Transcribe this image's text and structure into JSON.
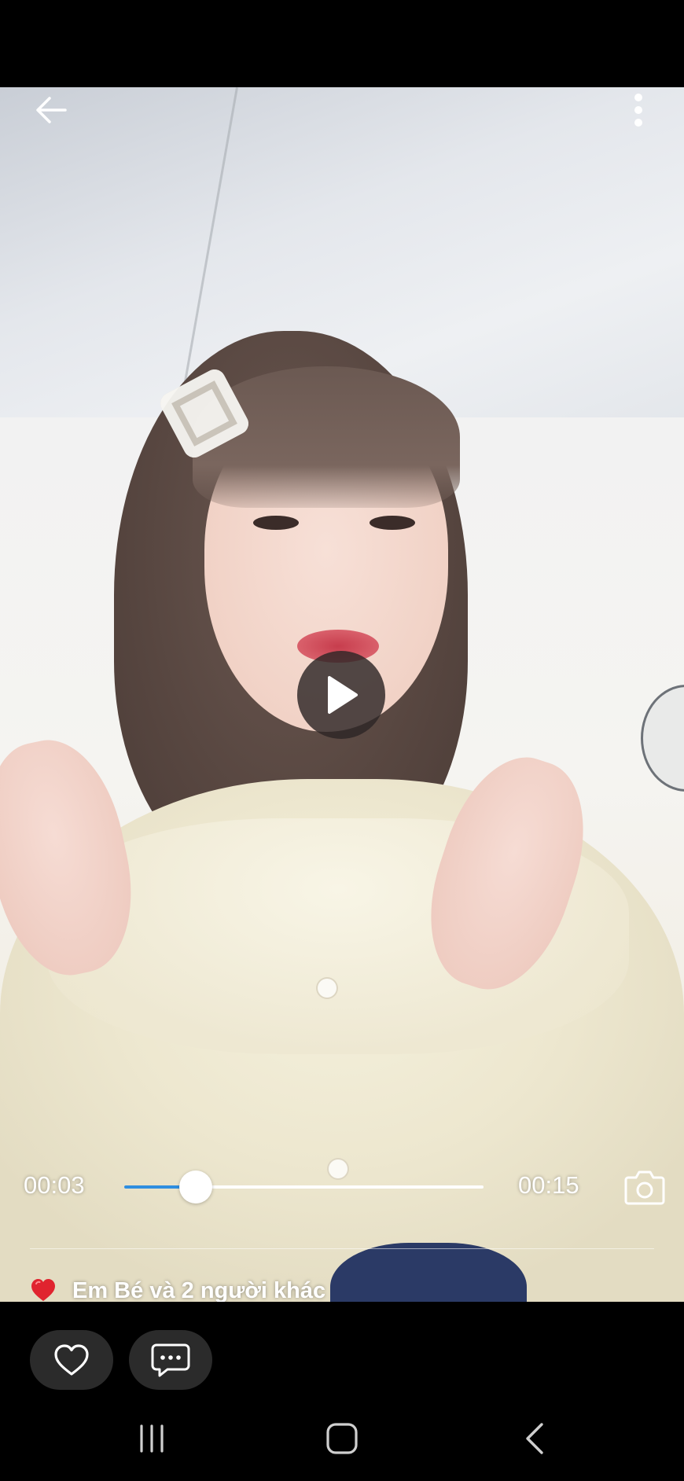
{
  "video": {
    "description_icon": "video-frame",
    "current_time": "00:03",
    "total_time": "00:15",
    "progress_fraction": 0.2
  },
  "top_bar": {
    "back_icon": "arrow-left-icon",
    "more_icon": "more-vertical-icon"
  },
  "controls": {
    "play_icon": "play-icon",
    "snapshot_icon": "camera-icon"
  },
  "reactions": {
    "heart_icon": "red-heart",
    "summary": "Em Bé và 2 người khác"
  },
  "actions": {
    "like_icon": "heart-outline-icon",
    "comment_icon": "chat-bubble-icon"
  },
  "system_nav": {
    "recents_icon": "recents-icon",
    "home_icon": "home-icon",
    "back_icon": "chevron-left-icon"
  },
  "colors": {
    "seek_fill": "#2f8ee0",
    "reaction_heart": "#e0242f",
    "pill_background": "#2b2b2b"
  }
}
